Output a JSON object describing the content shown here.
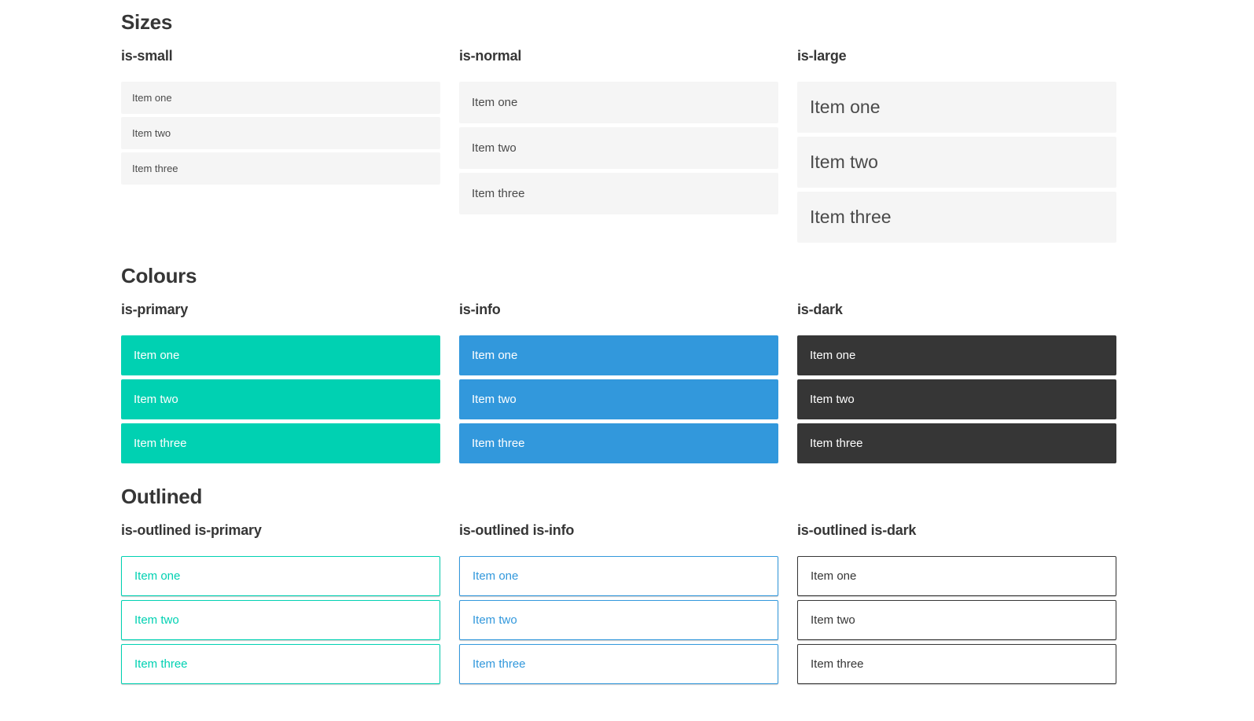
{
  "colors": {
    "primary": "#00d1b2",
    "info": "#3298dc",
    "dark": "#363636",
    "item_bg": "#f5f5f5",
    "item_text": "#4a4a4a",
    "item_text_on_color": "#ffffff",
    "heading_text": "#363636",
    "page_bg": "#ffffff"
  },
  "sections": [
    {
      "title": "Sizes",
      "groups": [
        {
          "label": "is-small",
          "items": [
            "Item one",
            "Item two",
            "Item three"
          ]
        },
        {
          "label": "is-normal",
          "items": [
            "Item one",
            "Item two",
            "Item three"
          ]
        },
        {
          "label": "is-large",
          "items": [
            "Item one",
            "Item two",
            "Item three"
          ]
        }
      ]
    },
    {
      "title": "Colours",
      "groups": [
        {
          "label": "is-primary",
          "items": [
            "Item one",
            "Item two",
            "Item three"
          ]
        },
        {
          "label": "is-info",
          "items": [
            "Item one",
            "Item two",
            "Item three"
          ]
        },
        {
          "label": "is-dark",
          "items": [
            "Item one",
            "Item two",
            "Item three"
          ]
        }
      ]
    },
    {
      "title": "Outlined",
      "groups": [
        {
          "label": "is-outlined is-primary",
          "items": [
            "Item one",
            "Item two",
            "Item three"
          ]
        },
        {
          "label": "is-outlined is-info",
          "items": [
            "Item one",
            "Item two",
            "Item three"
          ]
        },
        {
          "label": "is-outlined is-dark",
          "items": [
            "Item one",
            "Item two",
            "Item three"
          ]
        }
      ]
    }
  ]
}
